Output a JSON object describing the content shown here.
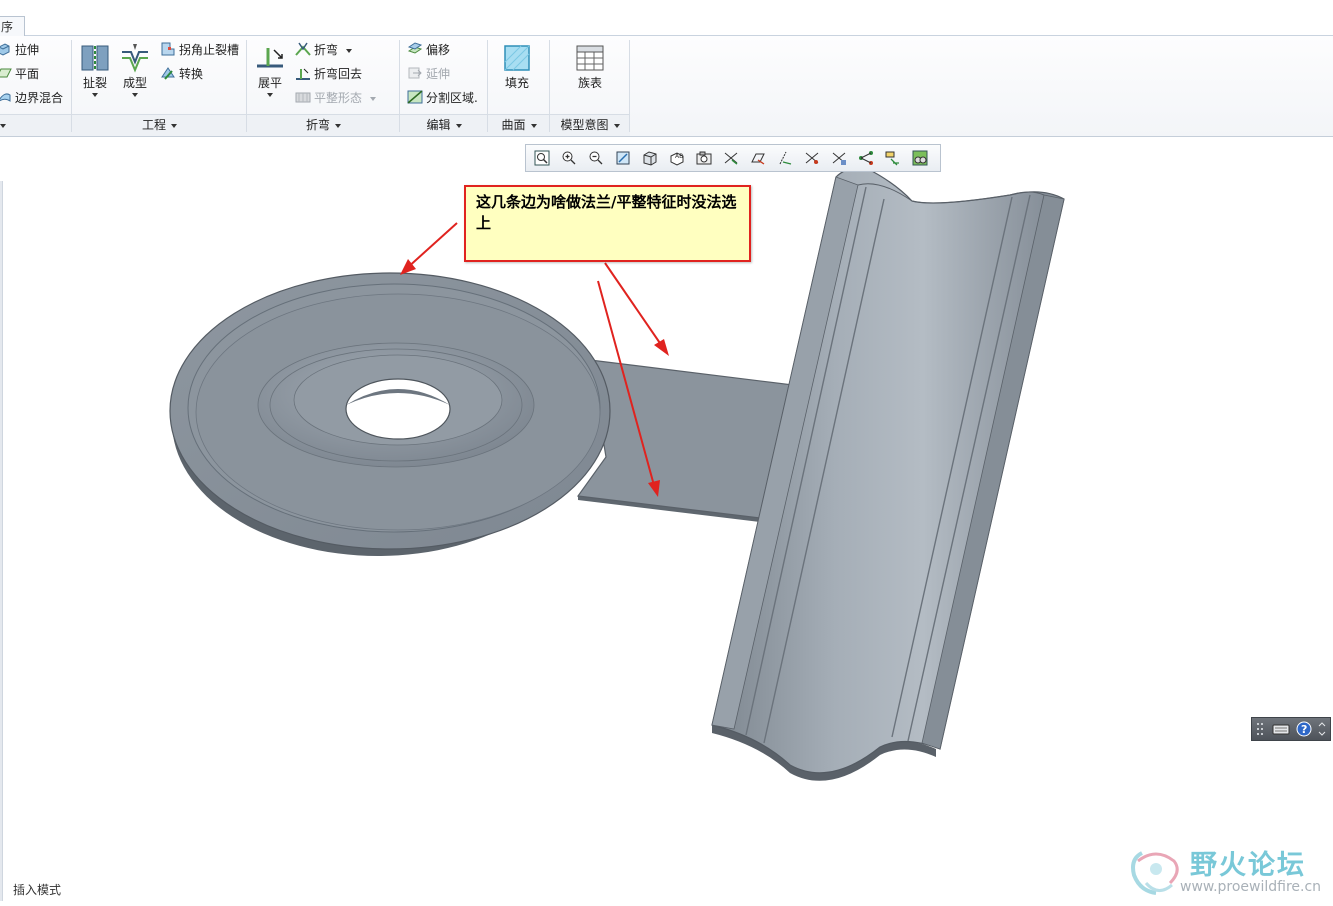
{
  "tabs": {
    "active_label": "序"
  },
  "ribbon": {
    "shape_group": {
      "items": [
        "拉伸",
        "平面",
        "边界混合"
      ]
    },
    "engineering_group": {
      "label": "工程",
      "rip": "扯裂",
      "form": "成型",
      "corner_relief": "拐角止裂槽",
      "convert": "转换"
    },
    "bend_group": {
      "label": "折弯",
      "unbend": "展平",
      "bend": "折弯",
      "bend_back": "折弯回去",
      "flat_state": "平整形态"
    },
    "editing_group": {
      "label": "编辑",
      "offset": "偏移",
      "extend": "延伸",
      "split_area": "分割区域."
    },
    "surfaces_group": {
      "label": "曲面",
      "fill": "填充"
    },
    "model_intent_group": {
      "label": "模型意图",
      "family_table": "族表"
    }
  },
  "view_toolbar": {
    "icons": [
      "refit-icon",
      "zoom-in-icon",
      "zoom-out-icon",
      "repaint-icon",
      "display-style-icon",
      "saved-views-icon",
      "view-manager-icon",
      "datum-planes-icon",
      "datum-axes-icon",
      "datum-points-icon",
      "coordinate-systems-icon",
      "annotations-icon",
      "spin-center-icon",
      "datum-display-filter-icon",
      "appearance-icon"
    ]
  },
  "annotation": {
    "text": "这几条边为啥做法兰/平整特征时没法选上"
  },
  "status": {
    "mode": "插入模式"
  },
  "watermark": {
    "title": "野火论坛",
    "url": "www.proewildfire.cn"
  },
  "colors": {
    "arrow": "#e0231f",
    "model": "#8b949e",
    "note_bg": "#ffffc0"
  }
}
